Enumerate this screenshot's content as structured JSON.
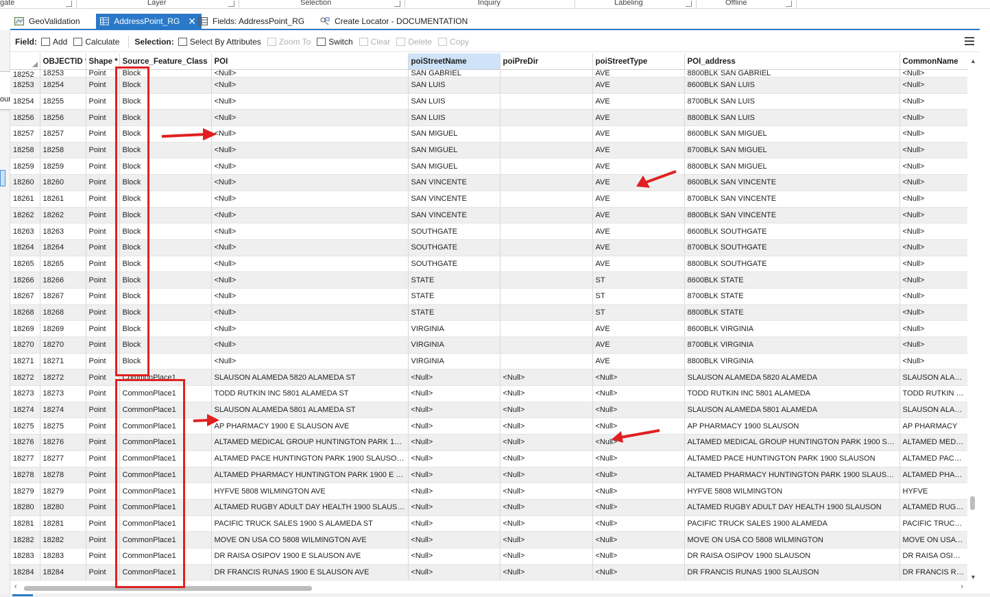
{
  "ribbon": {
    "groups": [
      {
        "label": "gate"
      },
      {
        "label": "Layer"
      },
      {
        "label": "Selection"
      },
      {
        "label": "Inquiry"
      },
      {
        "label": "Labeling"
      },
      {
        "label": "Offline"
      }
    ]
  },
  "tabs": [
    {
      "label": "GeoValidation",
      "icon": "map-icon",
      "active": false
    },
    {
      "label": "AddressPoint_RG",
      "icon": "table-icon",
      "active": true
    },
    {
      "label": "Fields: AddressPoint_RG",
      "icon": "fields-icon",
      "active": false
    },
    {
      "label": "Create Locator - DOCUMENTATION",
      "icon": "locator-icon",
      "active": false
    }
  ],
  "popup_text": "ource.",
  "toolbar": {
    "field_label": "Field:",
    "add": "Add",
    "calculate": "Calculate",
    "selection_label": "Selection:",
    "select_by_attributes": "Select By Attributes",
    "zoom_to": "Zoom To",
    "switch": "Switch",
    "clear": "Clear",
    "delete": "Delete",
    "copy": "Copy"
  },
  "table": {
    "columns": [
      "",
      "OBJECTID *",
      "Shape *",
      "Source_Feature_Class",
      "POI",
      "poiStreetName",
      "poiPreDir",
      "poiStreetType",
      "POI_address",
      "CommonName"
    ],
    "selected_column": "poiStreetName",
    "partial_top_row": [
      "18252",
      "18253",
      "Point",
      "Block",
      "<Null>",
      "SAN GABRIEL",
      "",
      "AVE",
      "8800BLK SAN GABRIEL",
      "<Null>"
    ],
    "rows": [
      [
        "18253",
        "18254",
        "Point",
        "Block",
        "<Null>",
        "SAN LUIS",
        "",
        "AVE",
        "8600BLK SAN LUIS",
        "<Null>"
      ],
      [
        "18254",
        "18255",
        "Point",
        "Block",
        "<Null>",
        "SAN LUIS",
        "",
        "AVE",
        "8700BLK SAN LUIS",
        "<Null>"
      ],
      [
        "18256",
        "18256",
        "Point",
        "Block",
        "<Null>",
        "SAN LUIS",
        "",
        "AVE",
        "8800BLK SAN LUIS",
        "<Null>"
      ],
      [
        "18257",
        "18257",
        "Point",
        "Block",
        "<Null>",
        "SAN MIGUEL",
        "",
        "AVE",
        "8600BLK SAN MIGUEL",
        "<Null>"
      ],
      [
        "18258",
        "18258",
        "Point",
        "Block",
        "<Null>",
        "SAN MIGUEL",
        "",
        "AVE",
        "8700BLK SAN MIGUEL",
        "<Null>"
      ],
      [
        "18259",
        "18259",
        "Point",
        "Block",
        "<Null>",
        "SAN MIGUEL",
        "",
        "AVE",
        "8800BLK SAN MIGUEL",
        "<Null>"
      ],
      [
        "18260",
        "18260",
        "Point",
        "Block",
        "<Null>",
        "SAN VINCENTE",
        "",
        "AVE",
        "8600BLK SAN VINCENTE",
        "<Null>"
      ],
      [
        "18261",
        "18261",
        "Point",
        "Block",
        "<Null>",
        "SAN VINCENTE",
        "",
        "AVE",
        "8700BLK SAN VINCENTE",
        "<Null>"
      ],
      [
        "18262",
        "18262",
        "Point",
        "Block",
        "<Null>",
        "SAN VINCENTE",
        "",
        "AVE",
        "8800BLK SAN VINCENTE",
        "<Null>"
      ],
      [
        "18263",
        "18263",
        "Point",
        "Block",
        "<Null>",
        "SOUTHGATE",
        "",
        "AVE",
        "8600BLK SOUTHGATE",
        "<Null>"
      ],
      [
        "18264",
        "18264",
        "Point",
        "Block",
        "<Null>",
        "SOUTHGATE",
        "",
        "AVE",
        "8700BLK SOUTHGATE",
        "<Null>"
      ],
      [
        "18265",
        "18265",
        "Point",
        "Block",
        "<Null>",
        "SOUTHGATE",
        "",
        "AVE",
        "8800BLK SOUTHGATE",
        "<Null>"
      ],
      [
        "18266",
        "18266",
        "Point",
        "Block",
        "<Null>",
        "STATE",
        "",
        "ST",
        "8600BLK STATE",
        "<Null>"
      ],
      [
        "18267",
        "18267",
        "Point",
        "Block",
        "<Null>",
        "STATE",
        "",
        "ST",
        "8700BLK STATE",
        "<Null>"
      ],
      [
        "18268",
        "18268",
        "Point",
        "Block",
        "<Null>",
        "STATE",
        "",
        "ST",
        "8800BLK STATE",
        "<Null>"
      ],
      [
        "18269",
        "18269",
        "Point",
        "Block",
        "<Null>",
        "VIRGINIA",
        "",
        "AVE",
        "8600BLK VIRGINIA",
        "<Null>"
      ],
      [
        "18270",
        "18270",
        "Point",
        "Block",
        "<Null>",
        "VIRGINIA",
        "",
        "AVE",
        "8700BLK VIRGINIA",
        "<Null>"
      ],
      [
        "18271",
        "18271",
        "Point",
        "Block",
        "<Null>",
        "VIRGINIA",
        "",
        "AVE",
        "8800BLK VIRGINIA",
        "<Null>"
      ],
      [
        "18272",
        "18272",
        "Point",
        "CommonPlace1",
        "SLAUSON ALAMEDA 5820  ALAMEDA ST",
        "<Null>",
        "<Null>",
        "<Null>",
        "SLAUSON ALAMEDA 5820 ALAMEDA",
        "SLAUSON ALAMED"
      ],
      [
        "18273",
        "18273",
        "Point",
        "CommonPlace1",
        "TODD RUTKIN INC 5801  ALAMEDA ST",
        "<Null>",
        "<Null>",
        "<Null>",
        "TODD RUTKIN INC 5801 ALAMEDA",
        "TODD RUTKIN INC"
      ],
      [
        "18274",
        "18274",
        "Point",
        "CommonPlace1",
        "SLAUSON ALAMEDA 5801  ALAMEDA ST",
        "<Null>",
        "<Null>",
        "<Null>",
        "SLAUSON ALAMEDA 5801 ALAMEDA",
        "SLAUSON ALAMED"
      ],
      [
        "18275",
        "18275",
        "Point",
        "CommonPlace1",
        "AP PHARMACY 1900 E SLAUSON AVE",
        "<Null>",
        "<Null>",
        "<Null>",
        "AP PHARMACY 1900 SLAUSON",
        "AP PHARMACY"
      ],
      [
        "18276",
        "18276",
        "Point",
        "CommonPlace1",
        "ALTAMED MEDICAL GROUP HUNTINGTON PARK 1900...",
        "<Null>",
        "<Null>",
        "<Null>",
        "ALTAMED MEDICAL GROUP HUNTINGTON PARK 1900 SLAU...",
        "ALTAMED MEDICAL"
      ],
      [
        "18277",
        "18277",
        "Point",
        "CommonPlace1",
        "ALTAMED PACE HUNTINGTON PARK 1900  SLAUSON A...",
        "<Null>",
        "<Null>",
        "<Null>",
        "ALTAMED PACE HUNTINGTON PARK 1900 SLAUSON",
        "ALTAMED PACE HU"
      ],
      [
        "18278",
        "18278",
        "Point",
        "CommonPlace1",
        "ALTAMED PHARMACY HUNTINGTON PARK 1900 E SLA...",
        "<Null>",
        "<Null>",
        "<Null>",
        "ALTAMED PHARMACY HUNTINGTON PARK 1900 SLAUSON",
        "ALTAMED PHARMA"
      ],
      [
        "18279",
        "18279",
        "Point",
        "CommonPlace1",
        "HYFVE 5808  WILMINGTON AVE",
        "<Null>",
        "<Null>",
        "<Null>",
        "HYFVE 5808 WILMINGTON",
        "HYFVE"
      ],
      [
        "18280",
        "18280",
        "Point",
        "CommonPlace1",
        "ALTAMED RUGBY ADULT DAY HEALTH 1900  SLAUSON...",
        "<Null>",
        "<Null>",
        "<Null>",
        "ALTAMED RUGBY ADULT DAY HEALTH 1900 SLAUSON",
        "ALTAMED RUGBY A"
      ],
      [
        "18281",
        "18281",
        "Point",
        "CommonPlace1",
        "PACIFIC TRUCK SALES 1900 S ALAMEDA ST",
        "<Null>",
        "<Null>",
        "<Null>",
        "PACIFIC TRUCK SALES 1900 ALAMEDA",
        "PACIFIC TRUCK SAL"
      ],
      [
        "18282",
        "18282",
        "Point",
        "CommonPlace1",
        "MOVE ON USA CO 5808  WILMINGTON AVE",
        "<Null>",
        "<Null>",
        "<Null>",
        "MOVE ON USA CO 5808 WILMINGTON",
        "MOVE ON USA CO"
      ],
      [
        "18283",
        "18283",
        "Point",
        "CommonPlace1",
        "DR RAISA OSIPOV 1900 E SLAUSON AVE",
        "<Null>",
        "<Null>",
        "<Null>",
        "DR RAISA OSIPOV 1900 SLAUSON",
        "DR RAISA OSIPOV"
      ],
      [
        "18284",
        "18284",
        "Point",
        "CommonPlace1",
        "DR FRANCIS RUNAS 1900 E SLAUSON AVE",
        "<Null>",
        "<Null>",
        "<Null>",
        "DR FRANCIS RUNAS 1900 SLAUSON",
        "DR FRANCIS RUNA"
      ]
    ]
  },
  "colors": {
    "accent": "#2a79c8",
    "annotation": "#e02020",
    "alt_row": "#efefef",
    "selected_header": "#cfe3f8"
  }
}
